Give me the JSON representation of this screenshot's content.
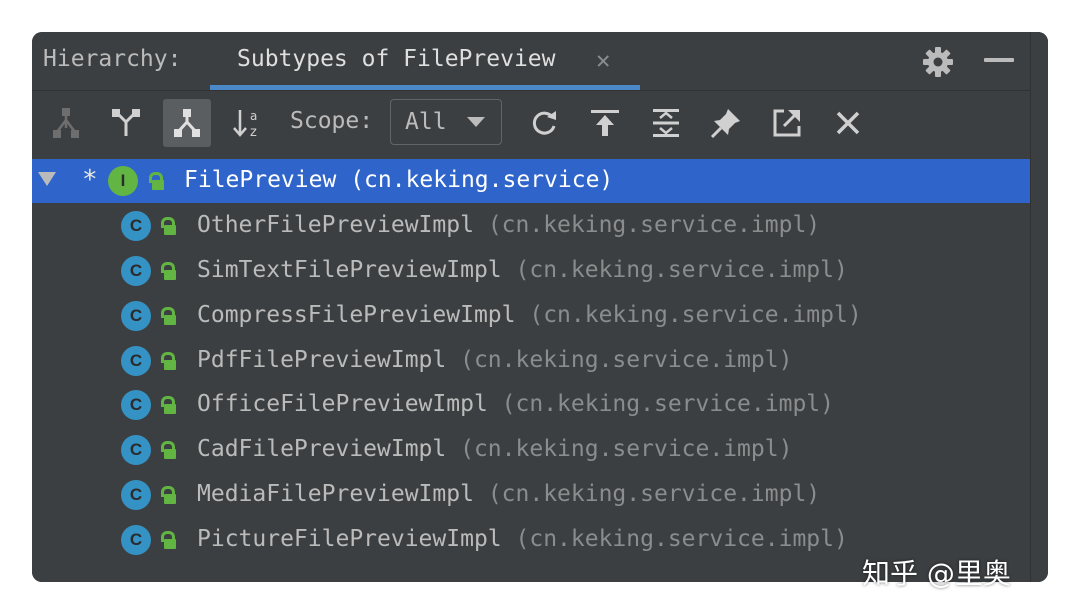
{
  "titlebar": {
    "label": "Hierarchy:",
    "tab_title": "Subtypes of FilePreview",
    "tab_close_icon": "close-icon",
    "gear_icon": "gear-icon",
    "minimize_icon": "minimize-icon"
  },
  "toolbar": {
    "scope_label": "Scope:",
    "scope_value": "All",
    "buttons": [
      "class-hierarchy-icon",
      "supertypes-hierarchy-icon",
      "subtypes-hierarchy-icon",
      "sort-alphabetically-icon",
      "refresh-icon",
      "export-icon",
      "expand-all-icon",
      "pin-icon",
      "open-in-new-tab-icon",
      "close-icon"
    ]
  },
  "tree": {
    "root": {
      "marker": "*",
      "badge": "I",
      "name": "FilePreview",
      "package": "(cn.keking.service)"
    },
    "children": [
      {
        "badge": "C",
        "name": "OtherFilePreviewImpl",
        "package": "(cn.keking.service.impl)"
      },
      {
        "badge": "C",
        "name": "SimTextFilePreviewImpl",
        "package": "(cn.keking.service.impl)"
      },
      {
        "badge": "C",
        "name": "CompressFilePreviewImpl",
        "package": "(cn.keking.service.impl)"
      },
      {
        "badge": "C",
        "name": "PdfFilePreviewImpl",
        "package": "(cn.keking.service.impl)"
      },
      {
        "badge": "C",
        "name": "OfficeFilePreviewImpl",
        "package": "(cn.keking.service.impl)"
      },
      {
        "badge": "C",
        "name": "CadFilePreviewImpl",
        "package": "(cn.keking.service.impl)"
      },
      {
        "badge": "C",
        "name": "MediaFilePreviewImpl",
        "package": "(cn.keking.service.impl)"
      },
      {
        "badge": "C",
        "name": "PictureFilePreviewImpl",
        "package": "(cn.keking.service.impl)"
      }
    ]
  },
  "watermark": "知乎 @里奥"
}
